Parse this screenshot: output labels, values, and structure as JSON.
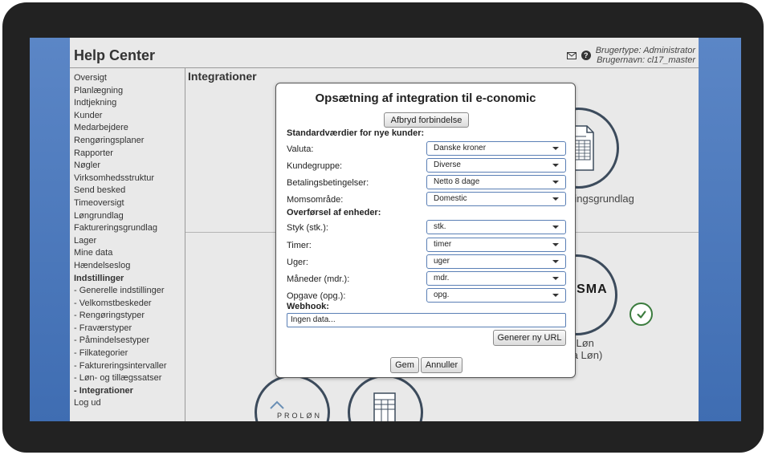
{
  "app": {
    "title": "Help Center",
    "user_type": "Brugertype: Administrator",
    "user_name": "Brugernavn: cl17_master"
  },
  "sidebar": {
    "items": [
      "Oversigt",
      "Planlægning",
      "Indtjekning",
      "Kunder",
      "Medarbejdere",
      "Rengøringsplaner",
      "Rapporter",
      "Nøgler",
      "Virksomhedsstruktur",
      "Send besked",
      "Timeoversigt",
      "Løngrundlag",
      "Faktureringsgrundlag",
      "Lager",
      "Mine data",
      "Hændelseslog"
    ],
    "settings_header": "Indstillinger",
    "settings_items": [
      "- Generelle indstillinger",
      "- Velkomstbeskeder",
      "- Rengøringstyper",
      "- Fraværstyper",
      "- Påmindelsestyper",
      "- Filkategorier",
      "- Faktureringsintervaller",
      "- Løn- og tillægssatser"
    ],
    "active_item": "- Integrationer",
    "logout": "Log ud"
  },
  "content": {
    "title": "Integrationer",
    "tiles": {
      "fakturering_label": "Faktureringsgrundlag",
      "multilon_label_1": "MultiLøn",
      "multilon_label_2": "(Visma Løn)",
      "visma_logo": "VISMA",
      "prolon_logo": "PROLØN"
    }
  },
  "modal": {
    "title": "Opsætning af integration til e-conomic",
    "disconnect_button": "Afbryd forbindelse",
    "section_defaults": "Standardværdier for nye kunder:",
    "defaults": [
      {
        "label": "Valuta:",
        "value": "Danske kroner"
      },
      {
        "label": "Kundegruppe:",
        "value": "Diverse"
      },
      {
        "label": "Betalingsbetingelser:",
        "value": "Netto 8 dage"
      },
      {
        "label": "Momsområde:",
        "value": "Domestic"
      }
    ],
    "section_units": "Overførsel af enheder:",
    "units": [
      {
        "label": "Styk (stk.):",
        "value": "stk."
      },
      {
        "label": "Timer:",
        "value": "timer"
      },
      {
        "label": "Uger:",
        "value": "uger"
      },
      {
        "label": "Måneder (mdr.):",
        "value": "mdr."
      },
      {
        "label": "Opgave (opg.):",
        "value": "opg."
      }
    ],
    "section_webhook": "Webhook:",
    "webhook_value": "Ingen data...",
    "generate_url_button": "Generer ny URL",
    "save_button": "Gem",
    "cancel_button": "Annuller"
  }
}
